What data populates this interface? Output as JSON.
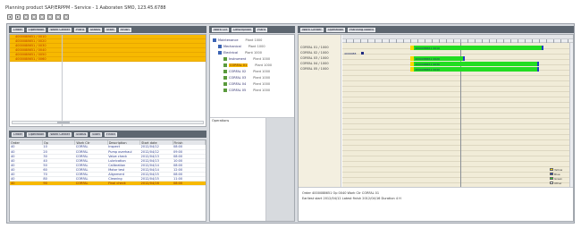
{
  "window": {
    "title": "Planning product SAP/ERPPM - Service - 1 Aaboraten SMO, 123.45.6788",
    "toolbar": [
      "◂",
      "▸",
      "◻",
      "◻",
      "◻",
      "◻",
      "◻",
      "◻"
    ]
  },
  "left_top": {
    "header_chips": [
      "Order",
      "Operation",
      "Work Center",
      "Plant",
      "Status",
      "Start",
      "Finish"
    ],
    "orders": [
      "4000088651 / 0010",
      "4000088651 / 0020",
      "4000088651 / 0030",
      "4000088651 / 0040",
      "4000088651 / 0050",
      "4000088651 / 0060"
    ]
  },
  "left_bottom": {
    "header_chips": [
      "Order",
      "Operation",
      "Work Center",
      "Status",
      "Start",
      "Finish"
    ],
    "columns": [
      "Order",
      "Op",
      "Work Ctr",
      "Description",
      "Start date",
      "Finish"
    ],
    "rows": [
      [
        "40",
        "10",
        "CORFAL",
        "Inspect",
        "2012/04/12",
        "08:00"
      ],
      [
        "40",
        "20",
        "CORFAL",
        "Pump overhaul",
        "2012/04/12",
        "09:00"
      ],
      [
        "40",
        "30",
        "CORFAL",
        "Valve check",
        "2012/04/13",
        "08:00"
      ],
      [
        "40",
        "40",
        "CORFAL",
        "Lubrication",
        "2012/04/13",
        "10:00"
      ],
      [
        "40",
        "50",
        "CORFAL",
        "Calibration",
        "2012/04/14",
        "08:00"
      ],
      [
        "40",
        "60",
        "CORFAL",
        "Motor test",
        "2012/04/14",
        "12:00"
      ],
      [
        "40",
        "70",
        "CORFAL",
        "Alignment",
        "2012/04/15",
        "08:00"
      ],
      [
        "40",
        "80",
        "CORFAL",
        "Cleaning",
        "2012/04/15",
        "11:00"
      ],
      [
        "40",
        "90",
        "CORFAL",
        "Final check",
        "2012/04/16",
        "08:00"
      ]
    ],
    "selected_row": 8
  },
  "middle": {
    "header_chips": [
      "Work Ctr",
      "Description",
      "Plant"
    ],
    "tree": [
      {
        "label": "Maintenance",
        "detail": "Plant 1000",
        "color": "#3c64b4",
        "indent": 0
      },
      {
        "label": "Mechanical",
        "detail": "Plant 1000",
        "color": "#3c64b4",
        "indent": 1
      },
      {
        "label": "Electrical",
        "detail": "Plant 1000",
        "color": "#3c64b4",
        "indent": 1
      },
      {
        "label": "Instrument",
        "detail": "Plant 1000",
        "color": "#5a9a3c",
        "indent": 2
      },
      {
        "label": "CORFAL 01",
        "detail": "Plant 1000",
        "color": "#5a9a3c",
        "indent": 2,
        "highlight": true
      },
      {
        "label": "CORFAL 02",
        "detail": "Plant 1000",
        "color": "#5a9a3c",
        "indent": 2
      },
      {
        "label": "CORFAL 03",
        "detail": "Plant 1000",
        "color": "#5a9a3c",
        "indent": 2
      },
      {
        "label": "CORFAL 04",
        "detail": "Plant 1000",
        "color": "#5a9a3c",
        "indent": 2
      },
      {
        "label": "CORFAL 05",
        "detail": "Plant 1000",
        "color": "#5a9a3c",
        "indent": 2
      }
    ],
    "lower_label": "Operations"
  },
  "right": {
    "header_chips": [
      "Work Center",
      "Operation",
      "Planning Board"
    ],
    "resources": [
      "CORFAL 01 / 1000",
      "CORFAL 02 / 1000",
      "CORFAL 03 / 1000",
      "CORFAL 04 / 1000",
      "CORFAL 05 / 1000"
    ],
    "marker_label": "4000088",
    "bars": [
      {
        "row": 0,
        "start": 0.31,
        "end": 0.86,
        "color": "#22dd22",
        "label": "4000088651 0010"
      },
      {
        "row": 2,
        "start": 0.31,
        "end": 0.52,
        "color": "#22dd22",
        "label": "4000088651 0020"
      },
      {
        "row": 3,
        "start": 0.31,
        "end": 0.84,
        "color": "#22dd22",
        "label": "4000088651 0030"
      },
      {
        "row": 4,
        "start": 0.31,
        "end": 0.84,
        "color": "#22dd22",
        "label": "4000088651 0040"
      }
    ],
    "now_position": 0.51,
    "legend": [
      {
        "label": "Yellow",
        "color": "#f7d900"
      },
      {
        "label": "Blue",
        "color": "#1f3fbf"
      },
      {
        "label": "Green",
        "color": "#22dd22"
      },
      {
        "label": "Other",
        "color": "#ffffff"
      }
    ],
    "status_lines": [
      "Order    4000088651   Op   0040   Work Ctr   CORFAL 01",
      "Earliest start  2012/04/12   Latest finish  2012/04/16   Duration  4 H"
    ]
  }
}
